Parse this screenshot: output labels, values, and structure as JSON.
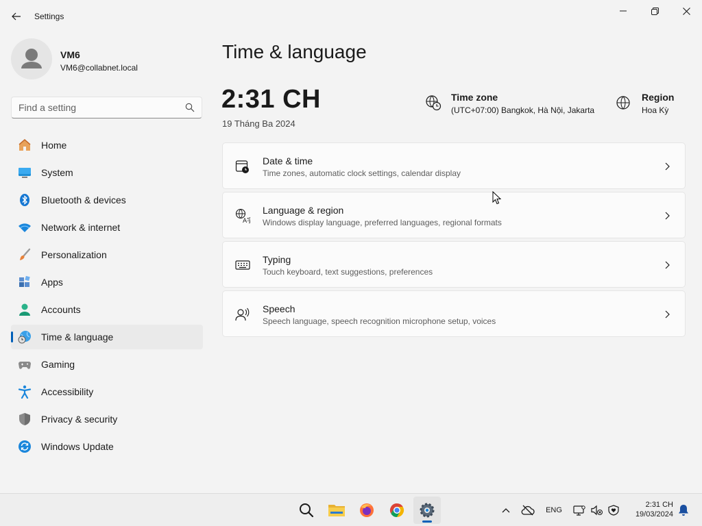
{
  "app": {
    "title": "Settings"
  },
  "profile": {
    "name": "VM6",
    "email": "VM6@collabnet.local"
  },
  "search": {
    "placeholder": "Find a setting"
  },
  "nav": [
    {
      "label": "Home",
      "icon": "home-icon",
      "active": false
    },
    {
      "label": "System",
      "icon": "system-icon",
      "active": false
    },
    {
      "label": "Bluetooth & devices",
      "icon": "bluetooth-icon",
      "active": false
    },
    {
      "label": "Network & internet",
      "icon": "wifi-icon",
      "active": false
    },
    {
      "label": "Personalization",
      "icon": "brush-icon",
      "active": false
    },
    {
      "label": "Apps",
      "icon": "apps-icon",
      "active": false
    },
    {
      "label": "Accounts",
      "icon": "accounts-icon",
      "active": false
    },
    {
      "label": "Time & language",
      "icon": "time-language-icon",
      "active": true
    },
    {
      "label": "Gaming",
      "icon": "gamepad-icon",
      "active": false
    },
    {
      "label": "Accessibility",
      "icon": "accessibility-icon",
      "active": false
    },
    {
      "label": "Privacy & security",
      "icon": "shield-icon",
      "active": false
    },
    {
      "label": "Windows Update",
      "icon": "update-icon",
      "active": false
    }
  ],
  "main": {
    "title": "Time & language",
    "time": "2:31 CH",
    "date": "19 Tháng Ba 2024",
    "timezone": {
      "title": "Time zone",
      "value": "(UTC+07:00) Bangkok, Hà Nội, Jakarta"
    },
    "region": {
      "title": "Region",
      "value": "Hoa Kỳ"
    },
    "cards": [
      {
        "title": "Date & time",
        "subtitle": "Time zones, automatic clock settings, calendar display",
        "icon": "calendar-clock-icon"
      },
      {
        "title": "Language & region",
        "subtitle": "Windows display language, preferred languages, regional formats",
        "icon": "language-icon"
      },
      {
        "title": "Typing",
        "subtitle": "Touch keyboard, text suggestions, preferences",
        "icon": "keyboard-icon"
      },
      {
        "title": "Speech",
        "subtitle": "Speech language, speech recognition microphone setup, voices",
        "icon": "speech-icon"
      }
    ]
  },
  "taskbar": {
    "apps": [
      {
        "name": "search-icon",
        "active": false
      },
      {
        "name": "file-explorer-icon",
        "active": false
      },
      {
        "name": "firefox-icon",
        "active": false
      },
      {
        "name": "chrome-icon",
        "active": false
      },
      {
        "name": "settings-icon",
        "active": true
      }
    ],
    "language": "ENG",
    "clock_time": "2:31 CH",
    "clock_date": "19/03/2024"
  },
  "colors": {
    "accent": "#005fb8",
    "background": "#f3f3f3",
    "card": "#fbfbfb"
  }
}
